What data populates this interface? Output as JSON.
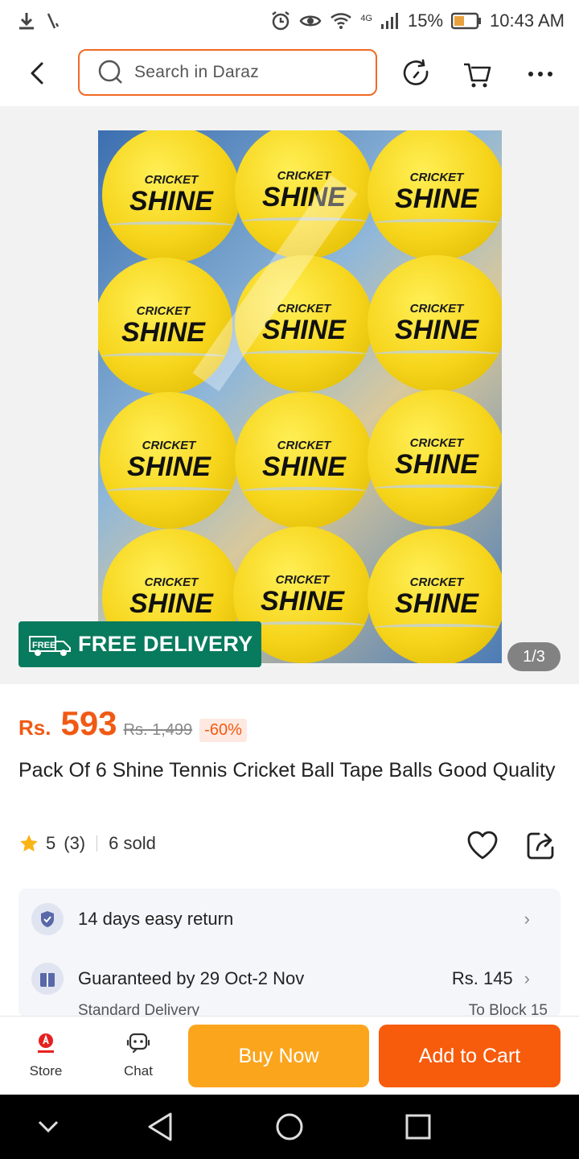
{
  "status_bar": {
    "network": "4G",
    "battery": "15%",
    "time": "10:43 AM"
  },
  "header": {
    "search_placeholder": "Search in Daraz"
  },
  "gallery": {
    "ball_brand_top": "CRICKET",
    "ball_brand_main": "SHINE",
    "free_delivery_icon_text": "FREE",
    "free_delivery_label": "FREE DELIVERY",
    "image_counter": "1/3"
  },
  "product": {
    "currency": "Rs.",
    "price": "593",
    "original_price": "Rs. 1,499",
    "discount": "-60%",
    "title": "Pack Of 6 Shine Tennis Cricket Ball Tape Balls Good Quality",
    "rating": "5",
    "rating_count": "(3)",
    "sold": "6 sold"
  },
  "info": {
    "return_text": "14 days easy return",
    "guarantee_text": "Guaranteed by 29 Oct-2 Nov",
    "delivery_fee": "Rs. 145",
    "delivery_type": "Standard Delivery",
    "delivery_location": "To Block 15"
  },
  "actions": {
    "store_label": "Store",
    "chat_label": "Chat",
    "buy_now_label": "Buy Now",
    "add_to_cart_label": "Add to Cart"
  },
  "colors": {
    "accent": "#f75b0c",
    "buy_now": "#fba51d",
    "free_delivery_badge": "#087a5d"
  }
}
